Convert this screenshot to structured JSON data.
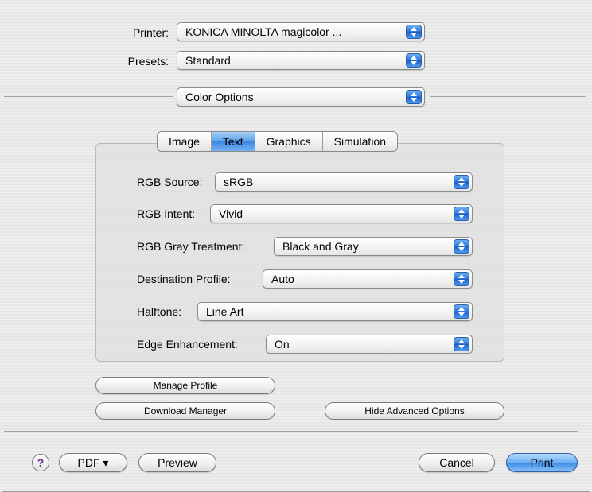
{
  "printer": {
    "label": "Printer:",
    "value": "KONICA MINOLTA magicolor ..."
  },
  "presets": {
    "label": "Presets:",
    "value": "Standard"
  },
  "panel": {
    "value": "Color Options"
  },
  "tabs": [
    {
      "label": "Image",
      "active": false
    },
    {
      "label": "Text",
      "active": true
    },
    {
      "label": "Graphics",
      "active": false
    },
    {
      "label": "Simulation",
      "active": false
    }
  ],
  "settings": [
    {
      "label": "RGB Source:",
      "value": "sRGB"
    },
    {
      "label": "RGB Intent:",
      "value": "Vivid"
    },
    {
      "label": "RGB Gray Treatment:",
      "value": "Black and Gray"
    },
    {
      "label": "Destination Profile:",
      "value": "Auto"
    },
    {
      "label": "Halftone:",
      "value": "Line Art"
    },
    {
      "label": "Edge Enhancement:",
      "value": "On"
    }
  ],
  "buttons": {
    "manage_profile": "Manage Profile",
    "download_manager": "Download Manager",
    "hide_advanced": "Hide Advanced Options"
  },
  "footer": {
    "help": "?",
    "pdf": "PDF ▾",
    "preview": "Preview",
    "cancel": "Cancel",
    "print": "Print"
  },
  "colors": {
    "accent_blue": "#3b86e0",
    "arrow_blue": "#2a73d6",
    "help_purple": "#6a2a9a"
  }
}
